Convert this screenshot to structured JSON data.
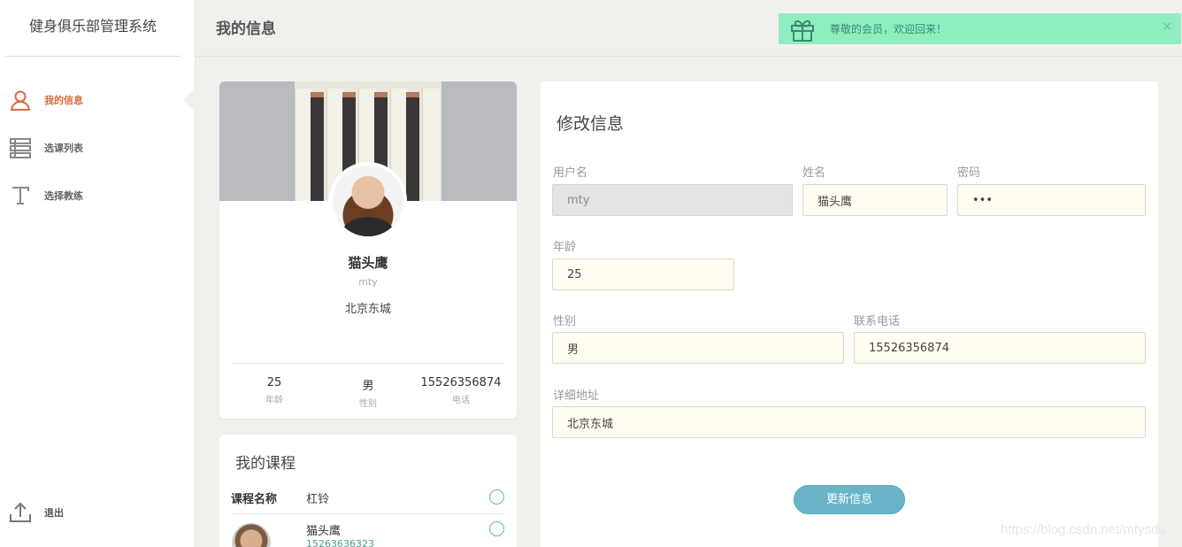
{
  "app": {
    "brand": "健身俱乐部管理系统"
  },
  "sidebar": {
    "items": [
      {
        "label": "我的信息",
        "icon": "user-icon",
        "active": true
      },
      {
        "label": "选课列表",
        "icon": "list-icon",
        "active": false
      },
      {
        "label": "选择教练",
        "icon": "text-icon",
        "active": false
      }
    ],
    "logout_label": "退出"
  },
  "header": {
    "title": "我的信息",
    "toast": {
      "message": "尊敬的会员，欢迎回来！",
      "close": "×",
      "icon": "gift-icon"
    }
  },
  "profile": {
    "name": "猫头鹰",
    "username": "mty",
    "address": "北京东城",
    "stats": [
      {
        "value": "25",
        "label": "年龄"
      },
      {
        "value": "男",
        "label": "性别"
      },
      {
        "value": "15526356874",
        "label": "电话"
      }
    ]
  },
  "courses": {
    "title": "我的课程",
    "header_label": "课程名称",
    "course_name": "杠铃",
    "coach": {
      "name": "猫头鹰",
      "phone": "15263636323"
    }
  },
  "form": {
    "title": "修改信息",
    "fields": {
      "username": {
        "label": "用户名",
        "value": "mty"
      },
      "name": {
        "label": "姓名",
        "value": "猫头鹰"
      },
      "password": {
        "label": "密码",
        "value": "•••"
      },
      "age": {
        "label": "年龄",
        "value": "25"
      },
      "gender": {
        "label": "性别",
        "value": "男"
      },
      "phone": {
        "label": "联系电话",
        "value": "15526356874"
      },
      "address": {
        "label": "详细地址",
        "value": "北京东城"
      }
    },
    "submit_label": "更新信息"
  },
  "watermark": "https://blog.csdn.net/mtysdu",
  "colors": {
    "accent": "#d86b3c",
    "toast_bg": "#8eeec2",
    "button": "#6ab4c8",
    "input_bg": "#fffcf2"
  }
}
